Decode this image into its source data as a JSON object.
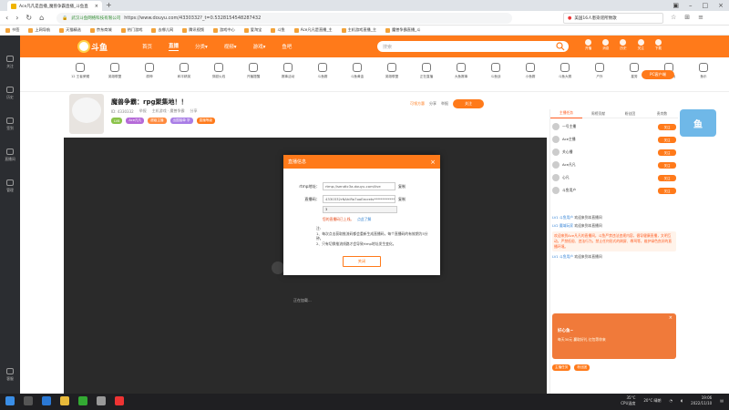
{
  "browser": {
    "tab_title": "Ace凡凡是直播_魔兽争霸直播_斗鱼直",
    "new_tab": "+",
    "url_org": "武汉斗鱼网络科技有限公司",
    "url": "https://www.douyu.com/4330332?_t=0.5328154548287432",
    "news": "美国16人患染谣所致歌",
    "bookmarks": [
      "书签",
      "上网导航",
      "天猫精选",
      "京东商城",
      "热门游戏",
      "去哪儿网",
      "腾讯视频",
      "游戏中心",
      "爱淘宝",
      "斗鱼",
      "Ace凡凡是直播_主",
      "主机游戏直播_主",
      "魔兽争霸直播_斗"
    ]
  },
  "rail": [
    "关注",
    "历史",
    "签到",
    "直播间",
    "管理",
    "客服"
  ],
  "site": {
    "logo": "斗鱼",
    "nav": [
      "首页",
      "直播",
      "分类▾",
      "视频▾",
      "游戏▾",
      "鱼吧"
    ],
    "nav_active": 1,
    "search_placeholder": "搜索",
    "header_icons": [
      "开播",
      "消息",
      "历史",
      "关注",
      "下载"
    ],
    "categories": [
      "12 王者荣耀",
      "英雄联盟",
      "原神",
      "和平精英",
      "穿越火线",
      "开播提醒",
      "赛事活动",
      "斗鱼赛",
      "斗鱼黄金",
      "英雄联盟",
      "正在直播",
      "大鱼赛事",
      "斗鱼战",
      "小鱼赛",
      "斗鱼大赛",
      "户外",
      "星秀",
      "主机游戏",
      "鱼乐",
      "更多"
    ],
    "pc_button": "PC客户端"
  },
  "room": {
    "title": "魔兽争霸：rpg聚集地！！",
    "meta": [
      "ID: 4330332",
      "举报",
      "主机游戏 · 魔兽争霸",
      "分享"
    ],
    "tags": [
      "LV8",
      "Ace凡凡",
      "超级主播",
      "出国接单 学",
      "直播等级"
    ],
    "follow": "关注",
    "share": "分享",
    "report": "举报",
    "level": "可领方惠",
    "loading": "正在加载..."
  },
  "panel": {
    "tabs": [
      "主播任务",
      "周榜贡献",
      "粉丝团",
      "贵宾数"
    ],
    "active_tab": 0,
    "rank": [
      {
        "name": "一号主播",
        "btn": "关注"
      },
      {
        "name": "Ace主播",
        "btn": "关注"
      },
      {
        "name": "关心播",
        "btn": "关注"
      },
      {
        "name": "Ace凡凡",
        "btn": "关注"
      },
      {
        "name": "心凡",
        "btn": "关注"
      },
      {
        "name": "斗鱼用户",
        "btn": "关注"
      }
    ],
    "messages": [
      {
        "user": "LV1 斗鱼用户",
        "text": "欢迎来到本直播间"
      },
      {
        "user": "LV2 魔域玩家",
        "text": "欢迎来到本直播间"
      },
      {
        "user": "",
        "text": "欢迎来到Ace凡凡的直播间，斗鱼严禁违法违规内容，倡导健康直播，文明互动，严禁低俗、违法行为，禁止任何形式的刷屏、辱骂等，维护绿色良好的直播环境。",
        "sys": true
      },
      {
        "user": "LV1 斗鱼用户",
        "text": "欢迎来到本直播间"
      }
    ],
    "ad_title": "好心鱼~",
    "ad_sub": "每天30元 赢取好礼 红包等你来",
    "ad_close": "×",
    "bottom": [
      "主播任务",
      "粉丝团"
    ]
  },
  "mascot": "鱼",
  "modal": {
    "title": "直播信息",
    "close": "×",
    "rtmp_label": "rtmp地址：",
    "rtmp_value": "rtmp://sendtc3a.douyu.com/live",
    "code_label": "直播码：",
    "code_value": "4330332rNAhiRo7ooEecrets*************",
    "copy": "复制",
    "select": "3",
    "warn": "您的直播码已上线。",
    "warn_link": "点此了解",
    "notes_title": "注:",
    "notes": [
      "1、每次点击获取推流码都会重新生成直播码，每个直播码的有效期为5分钟。",
      "2、只有切换推流线路才会导致rtmp地址发生变化。"
    ],
    "ok": "关闭"
  },
  "taskbar": {
    "weather_temp": "35°C",
    "weather_label": "CPU温度",
    "temp2": "20°C 晴朗",
    "time": "19:06",
    "date": "2022/11/10"
  }
}
